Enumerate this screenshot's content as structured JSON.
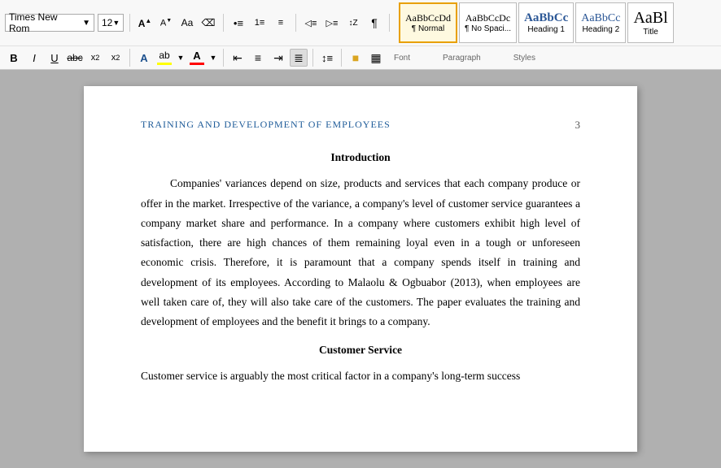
{
  "toolbar": {
    "font_name": "Times New Rom",
    "font_size": "12",
    "row1_buttons": [
      {
        "name": "grow-font",
        "label": "A",
        "sub": "▲"
      },
      {
        "name": "shrink-font",
        "label": "A",
        "sub": "▼"
      },
      {
        "name": "change-case",
        "label": "Aa"
      },
      {
        "name": "clear-format",
        "label": "A̲"
      },
      {
        "name": "list-bullets",
        "label": "≡"
      },
      {
        "name": "list-numbers",
        "label": "≡"
      },
      {
        "name": "multilevel-list",
        "label": "☰"
      },
      {
        "name": "decrease-indent",
        "label": "◁"
      },
      {
        "name": "increase-indent",
        "label": "▷"
      },
      {
        "name": "sort",
        "label": "↕Z"
      },
      {
        "name": "show-para",
        "label": "¶"
      }
    ],
    "row2_buttons": [
      {
        "name": "bold",
        "label": "B"
      },
      {
        "name": "italic",
        "label": "I"
      },
      {
        "name": "underline",
        "label": "U"
      },
      {
        "name": "strikethrough",
        "label": "abc"
      },
      {
        "name": "subscript",
        "label": "x₂"
      },
      {
        "name": "superscript",
        "label": "x²"
      },
      {
        "name": "text-effects",
        "label": "A"
      },
      {
        "name": "highlight",
        "label": "ab"
      },
      {
        "name": "font-color",
        "label": "A"
      },
      {
        "name": "align-left",
        "label": "≡"
      },
      {
        "name": "align-center",
        "label": "≡"
      },
      {
        "name": "align-right",
        "label": "≡"
      },
      {
        "name": "justify",
        "label": "≡"
      },
      {
        "name": "line-spacing",
        "label": "↕"
      },
      {
        "name": "shading",
        "label": "⬛"
      },
      {
        "name": "borders",
        "label": "⊞"
      }
    ]
  },
  "styles": [
    {
      "name": "normal",
      "preview": "AaBbCcDd",
      "label": "¶ Normal",
      "active": true
    },
    {
      "name": "no-spacing",
      "preview": "AaBbCcDc",
      "label": "¶ No Spaci...",
      "active": false
    },
    {
      "name": "heading1",
      "preview": "AaBbCc",
      "label": "Heading 1",
      "active": false
    },
    {
      "name": "heading2",
      "preview": "AaBbCc",
      "label": "Heading 2",
      "active": false
    },
    {
      "name": "title",
      "preview": "AaBl",
      "label": "Title",
      "active": false
    }
  ],
  "groups": [
    {
      "label": "Font"
    },
    {
      "label": "Paragraph"
    },
    {
      "label": "Styles"
    }
  ],
  "document": {
    "header_title": "TRAINING AND DEVELOPMENT OF EMPLOYEES",
    "page_number": "3",
    "sections": [
      {
        "type": "heading",
        "text": "Introduction"
      },
      {
        "type": "paragraph",
        "text": "Companies' variances depend on size, products and services that each company produce or offer in the market. Irrespective of the variance, a company's level of customer service guarantees a company market share and performance. In a company where customers exhibit high level of satisfaction, there are high chances of them remaining loyal even in a tough or unforeseen economic crisis. Therefore, it is paramount that a company spends itself in training and development of its employees. According to Malaolu & Ogbuabor (2013), when employees are well taken care of, they will also take care of the customers. The paper evaluates the training and development of employees and the benefit it brings to a company."
      },
      {
        "type": "heading",
        "text": "Customer Service"
      },
      {
        "type": "paragraph",
        "text": "Customer service is arguably the most critical factor in a company's long-term success"
      }
    ]
  }
}
